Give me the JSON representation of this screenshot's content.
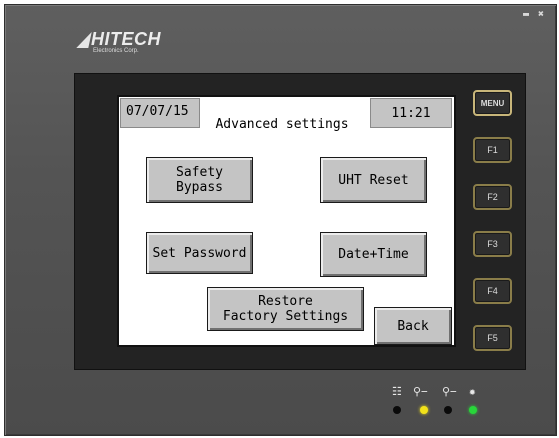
{
  "brand": {
    "name": "HITECH",
    "sub": "Electronics Corp."
  },
  "window": {
    "minimize_icon": "minimize-icon",
    "close_icon": "close-icon"
  },
  "screen": {
    "date": "07/07/15",
    "title": "Advanced settings",
    "time": "11:21",
    "buttons": {
      "safety_bypass": "Safety\nBypass",
      "uht_reset": "UHT Reset",
      "set_password": "Set Password",
      "date_time": "Date+Time",
      "restore": "Restore\nFactory Settings",
      "back": "Back"
    }
  },
  "side_keys": [
    "MENU",
    "F1",
    "F2",
    "F3",
    "F4",
    "F5"
  ],
  "indicators": {
    "icons": [
      "network-icon",
      "key-icon",
      "key-icon",
      "light-icon"
    ],
    "led_colors": [
      "#0a0a0a",
      "#f2e21a",
      "#0a0a0a",
      "#28d63a"
    ]
  },
  "colors": {
    "frame": "#545454",
    "button": "#c4c4c4",
    "key_border": "#8a7d49"
  }
}
